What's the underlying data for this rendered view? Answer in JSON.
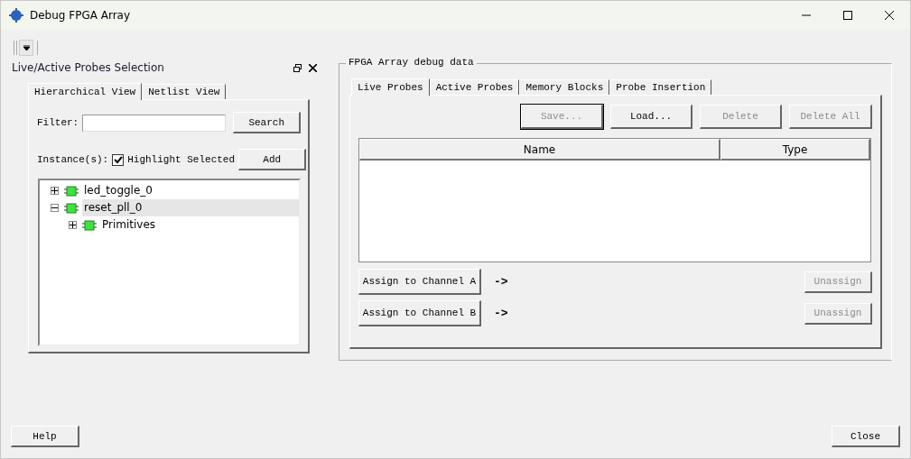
{
  "window": {
    "title": "Debug FPGA Array"
  },
  "left_panel": {
    "title": "Live/Active Probes Selection",
    "tabs": [
      {
        "label": "Hierarchical View",
        "selected": true
      },
      {
        "label": "Netlist View",
        "selected": false
      }
    ],
    "filter": {
      "label": "Filter:"
    },
    "search_button": {
      "label": "Search",
      "disabled": false
    },
    "instances_label": "Instance(s):",
    "highlight": {
      "label": "Highlight Selected",
      "checked": true
    },
    "add_button": {
      "label": "Add",
      "disabled": false
    },
    "tree": [
      {
        "label": "led_toggle_0",
        "expanded": false,
        "selected": false
      },
      {
        "label": "reset_pll_0",
        "expanded": true,
        "selected": true,
        "children": [
          {
            "label": "Primitives",
            "expanded": false,
            "selected": false
          }
        ]
      }
    ]
  },
  "debug_group": {
    "title": "FPGA Array debug data",
    "tabs": [
      {
        "label": "Live Probes",
        "selected": true
      },
      {
        "label": "Active Probes",
        "selected": false
      },
      {
        "label": "Memory Blocks",
        "selected": false
      },
      {
        "label": "Probe Insertion",
        "selected": false
      }
    ],
    "buttons": [
      {
        "label": "Save...",
        "disabled": true
      },
      {
        "label": "Load...",
        "disabled": false
      },
      {
        "label": "Delete",
        "disabled": true
      },
      {
        "label": "Delete All",
        "disabled": true
      }
    ],
    "table": {
      "columns": [
        "Name",
        "Type"
      ]
    },
    "channels": [
      {
        "assign": {
          "label": "Assign to Channel A",
          "disabled": false
        },
        "arrow": "->",
        "unassign": {
          "label": "Unassign",
          "disabled": true
        }
      },
      {
        "assign": {
          "label": "Assign to Channel B",
          "disabled": false
        },
        "arrow": "->",
        "unassign": {
          "label": "Unassign",
          "disabled": true
        }
      }
    ]
  },
  "footer": {
    "buttons": [
      {
        "label": "Help",
        "disabled": false
      },
      {
        "label": "Close",
        "disabled": false
      }
    ]
  }
}
